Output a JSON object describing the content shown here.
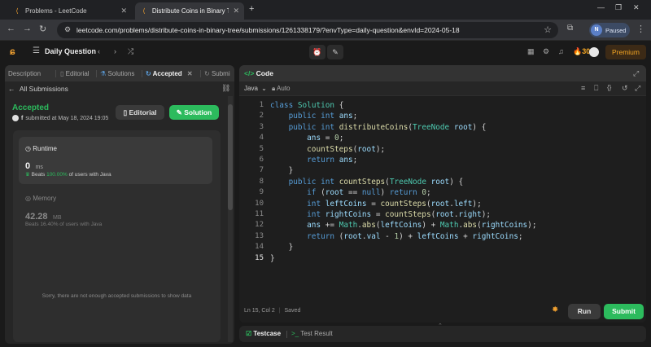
{
  "browser": {
    "tabs": [
      {
        "title": "Problems - LeetCode",
        "active": false
      },
      {
        "title": "Distribute Coins in Binary Tree",
        "active": true
      }
    ],
    "url": "leetcode.com/problems/distribute-coins-in-binary-tree/submissions/1261338179/?envType=daily-question&envId=2024-05-18",
    "profile_initial": "N",
    "profile_status": "Paused"
  },
  "lc_nav": {
    "title": "Daily Question",
    "streak": "30",
    "premium": "Premium"
  },
  "left_panel": {
    "tabs": [
      "Description",
      "Editorial",
      "Solutions",
      "Accepted",
      "Submissions"
    ],
    "tab_visible": [
      "Description",
      "Editorial",
      "Solutions",
      "Accepted",
      "Submi"
    ],
    "back_label": "All Submissions",
    "status": "Accepted",
    "submitted_text": "submitted at May 18, 2024 19:05",
    "editorial_btn": "Editorial",
    "solution_btn": "Solution",
    "runtime": {
      "label": "Runtime",
      "value": "0",
      "unit": "ms",
      "beats_prefix": "Beats",
      "beats_pct": "100.00%",
      "beats_suffix": "of users with Java"
    },
    "memory": {
      "label": "Memory",
      "value": "42.28",
      "unit": "MB",
      "beats_text": "Beats 16.40% of users with Java"
    },
    "empty_message": "Sorry, there are not enough accepted submissions to show data"
  },
  "code_panel": {
    "title": "Code",
    "language": "Java",
    "mode": "Auto",
    "status_pos": "Ln 15, Col 2",
    "status_saved": "Saved",
    "run_btn": "Run",
    "submit_btn": "Submit",
    "bottom_tabs": [
      "Testcase",
      "Test Result"
    ],
    "lines": [
      "class Solution {",
      "    public int ans;",
      "    public int distributeCoins(TreeNode root) {",
      "        ans = 0;",
      "        countSteps(root);",
      "        return ans;",
      "    }",
      "    public int countSteps(TreeNode root) {",
      "        if (root == null) return 0;",
      "        int leftCoins = countSteps(root.left);",
      "        int rightCoins = countSteps(root.right);",
      "        ans += Math.abs(leftCoins) + Math.abs(rightCoins);",
      "        return (root.val - 1) + leftCoins + rightCoins;",
      "    }",
      "}"
    ]
  },
  "colors": {
    "accent_green": "#2cbb5d",
    "streak_orange": "#f5a623",
    "accent_blue": "#569cd6"
  }
}
